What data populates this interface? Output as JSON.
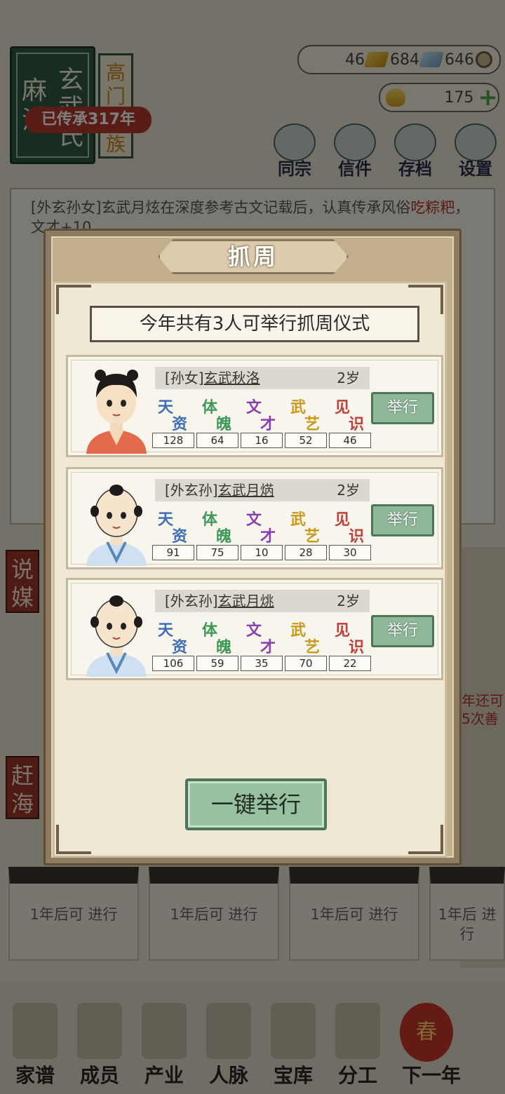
{
  "clan": {
    "surname": "麻沙",
    "name": "玄武氏",
    "tag": "高门大族",
    "years": "已传承317年"
  },
  "resources": {
    "gold": "46",
    "silver": "684",
    "coins": "646",
    "yuanbao": "175"
  },
  "top_buttons": [
    "同宗",
    "信件",
    "存档",
    "设置"
  ],
  "log": {
    "prefix": "[外玄孙女]玄武月炫在深度参考古文记载后，认真传承风俗",
    "highlight": "吃粽粑",
    "suffix": "，文才+10"
  },
  "side_tags": [
    "说媒",
    "赶海"
  ],
  "right_text": "年还可 5次善",
  "slots": [
    "1年后可 进行",
    "1年后可 进行",
    "1年后可 进行",
    "1年后 进行"
  ],
  "bottom_nav": [
    "家谱",
    "成员",
    "产业",
    "人脉",
    "宝库",
    "分工",
    "下一年"
  ],
  "next_year_badge": "春",
  "dialog": {
    "title": "抓周",
    "headline": "今年共有3人可举行抓周仪式",
    "hold_label": "举行",
    "hold_all_label": "一键举行",
    "stat_labels": [
      {
        "a": "天",
        "b": "资",
        "color": "#3f6fb8"
      },
      {
        "a": "体",
        "b": "魄",
        "color": "#3f9a5a"
      },
      {
        "a": "文",
        "b": "才",
        "color": "#8a3fb0"
      },
      {
        "a": "武",
        "b": "艺",
        "color": "#c99a1e"
      },
      {
        "a": "见",
        "b": "识",
        "color": "#c2403a"
      }
    ],
    "children": [
      {
        "title": "[孙女]",
        "name": "玄武秋洛",
        "age": "2岁",
        "stats": [
          "128",
          "64",
          "16",
          "52",
          "46"
        ],
        "gender": "girl"
      },
      {
        "title": "[外玄孙]",
        "name": "玄武月焫",
        "age": "2岁",
        "stats": [
          "91",
          "75",
          "10",
          "28",
          "30"
        ],
        "gender": "boy"
      },
      {
        "title": "[外玄孙]",
        "name": "玄武月烑",
        "age": "2岁",
        "stats": [
          "106",
          "59",
          "35",
          "70",
          "22"
        ],
        "gender": "boy"
      }
    ]
  }
}
